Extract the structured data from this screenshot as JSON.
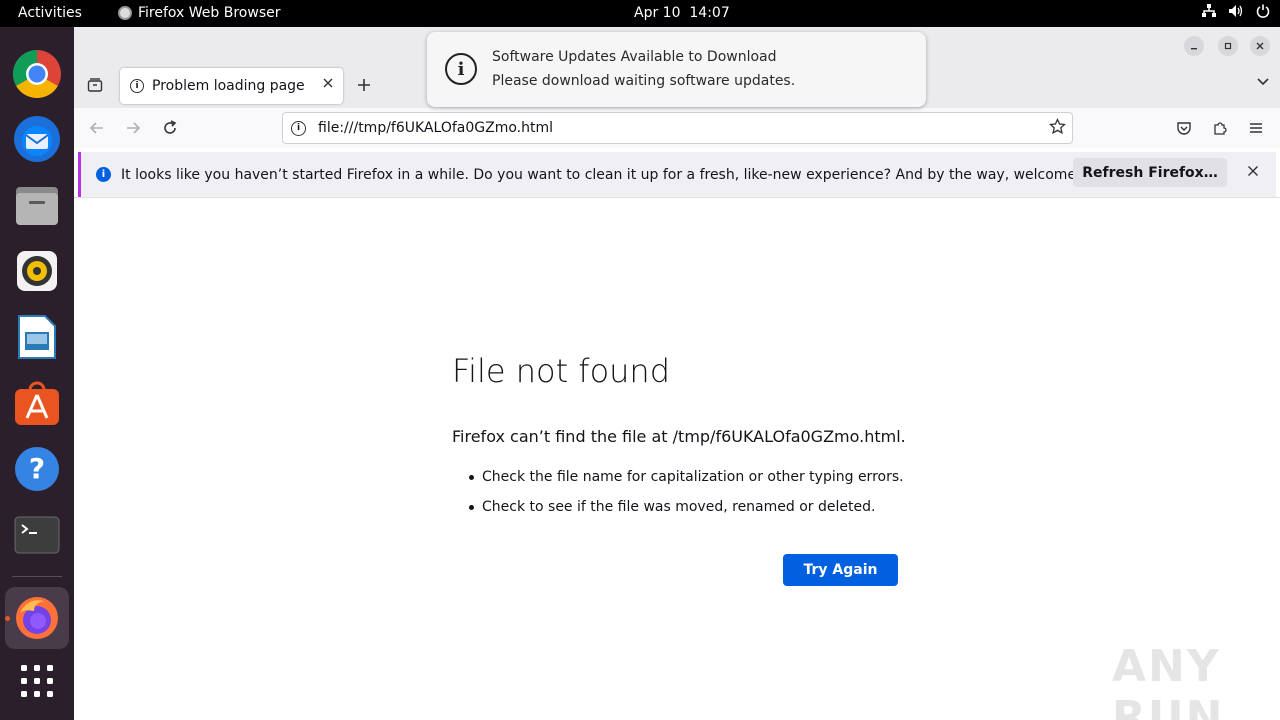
{
  "topbar": {
    "activities": "Activities",
    "app_name": "Firefox Web Browser",
    "date": "Apr 10",
    "time": "14:07"
  },
  "dock": {
    "items": [
      {
        "name": "chrome-icon",
        "color": "#4285f4"
      },
      {
        "name": "thunderbird-icon",
        "color": "#0a84ff"
      },
      {
        "name": "files-icon",
        "color": "#777777"
      },
      {
        "name": "rhythmbox-icon",
        "color": "#f0c000"
      },
      {
        "name": "libreoffice-writer-icon",
        "color": "#2a7ab8"
      },
      {
        "name": "app-center-icon",
        "color": "#e95420"
      },
      {
        "name": "help-icon",
        "color": "#3584e4"
      },
      {
        "name": "terminal-icon",
        "color": "#3d3d3d"
      },
      {
        "name": "firefox-icon",
        "color": "#ff7139"
      },
      {
        "name": "app-grid-icon",
        "color": "#ffffff"
      }
    ]
  },
  "browser": {
    "tab_title": "Problem loading page",
    "url": "file:///tmp/f6UKALOfa0GZmo.html",
    "notification_text": "It looks like you haven’t started Firefox in a while. Do you want to clean it up for a fresh, like-new experience? And by the way, welcome back!",
    "refresh_label": "Refresh Firefox…"
  },
  "error_page": {
    "title": "File not found",
    "description": "Firefox can’t find the file at /tmp/f6UKALOfa0GZmo.html.",
    "tips": [
      "Check the file name for capitalization or other typing errors.",
      "Check to see if the file was moved, renamed or deleted."
    ],
    "try_again": "Try Again"
  },
  "toast": {
    "title": "Software Updates Available to Download",
    "body": "Please download waiting software updates."
  },
  "watermark": "ANY RUN"
}
